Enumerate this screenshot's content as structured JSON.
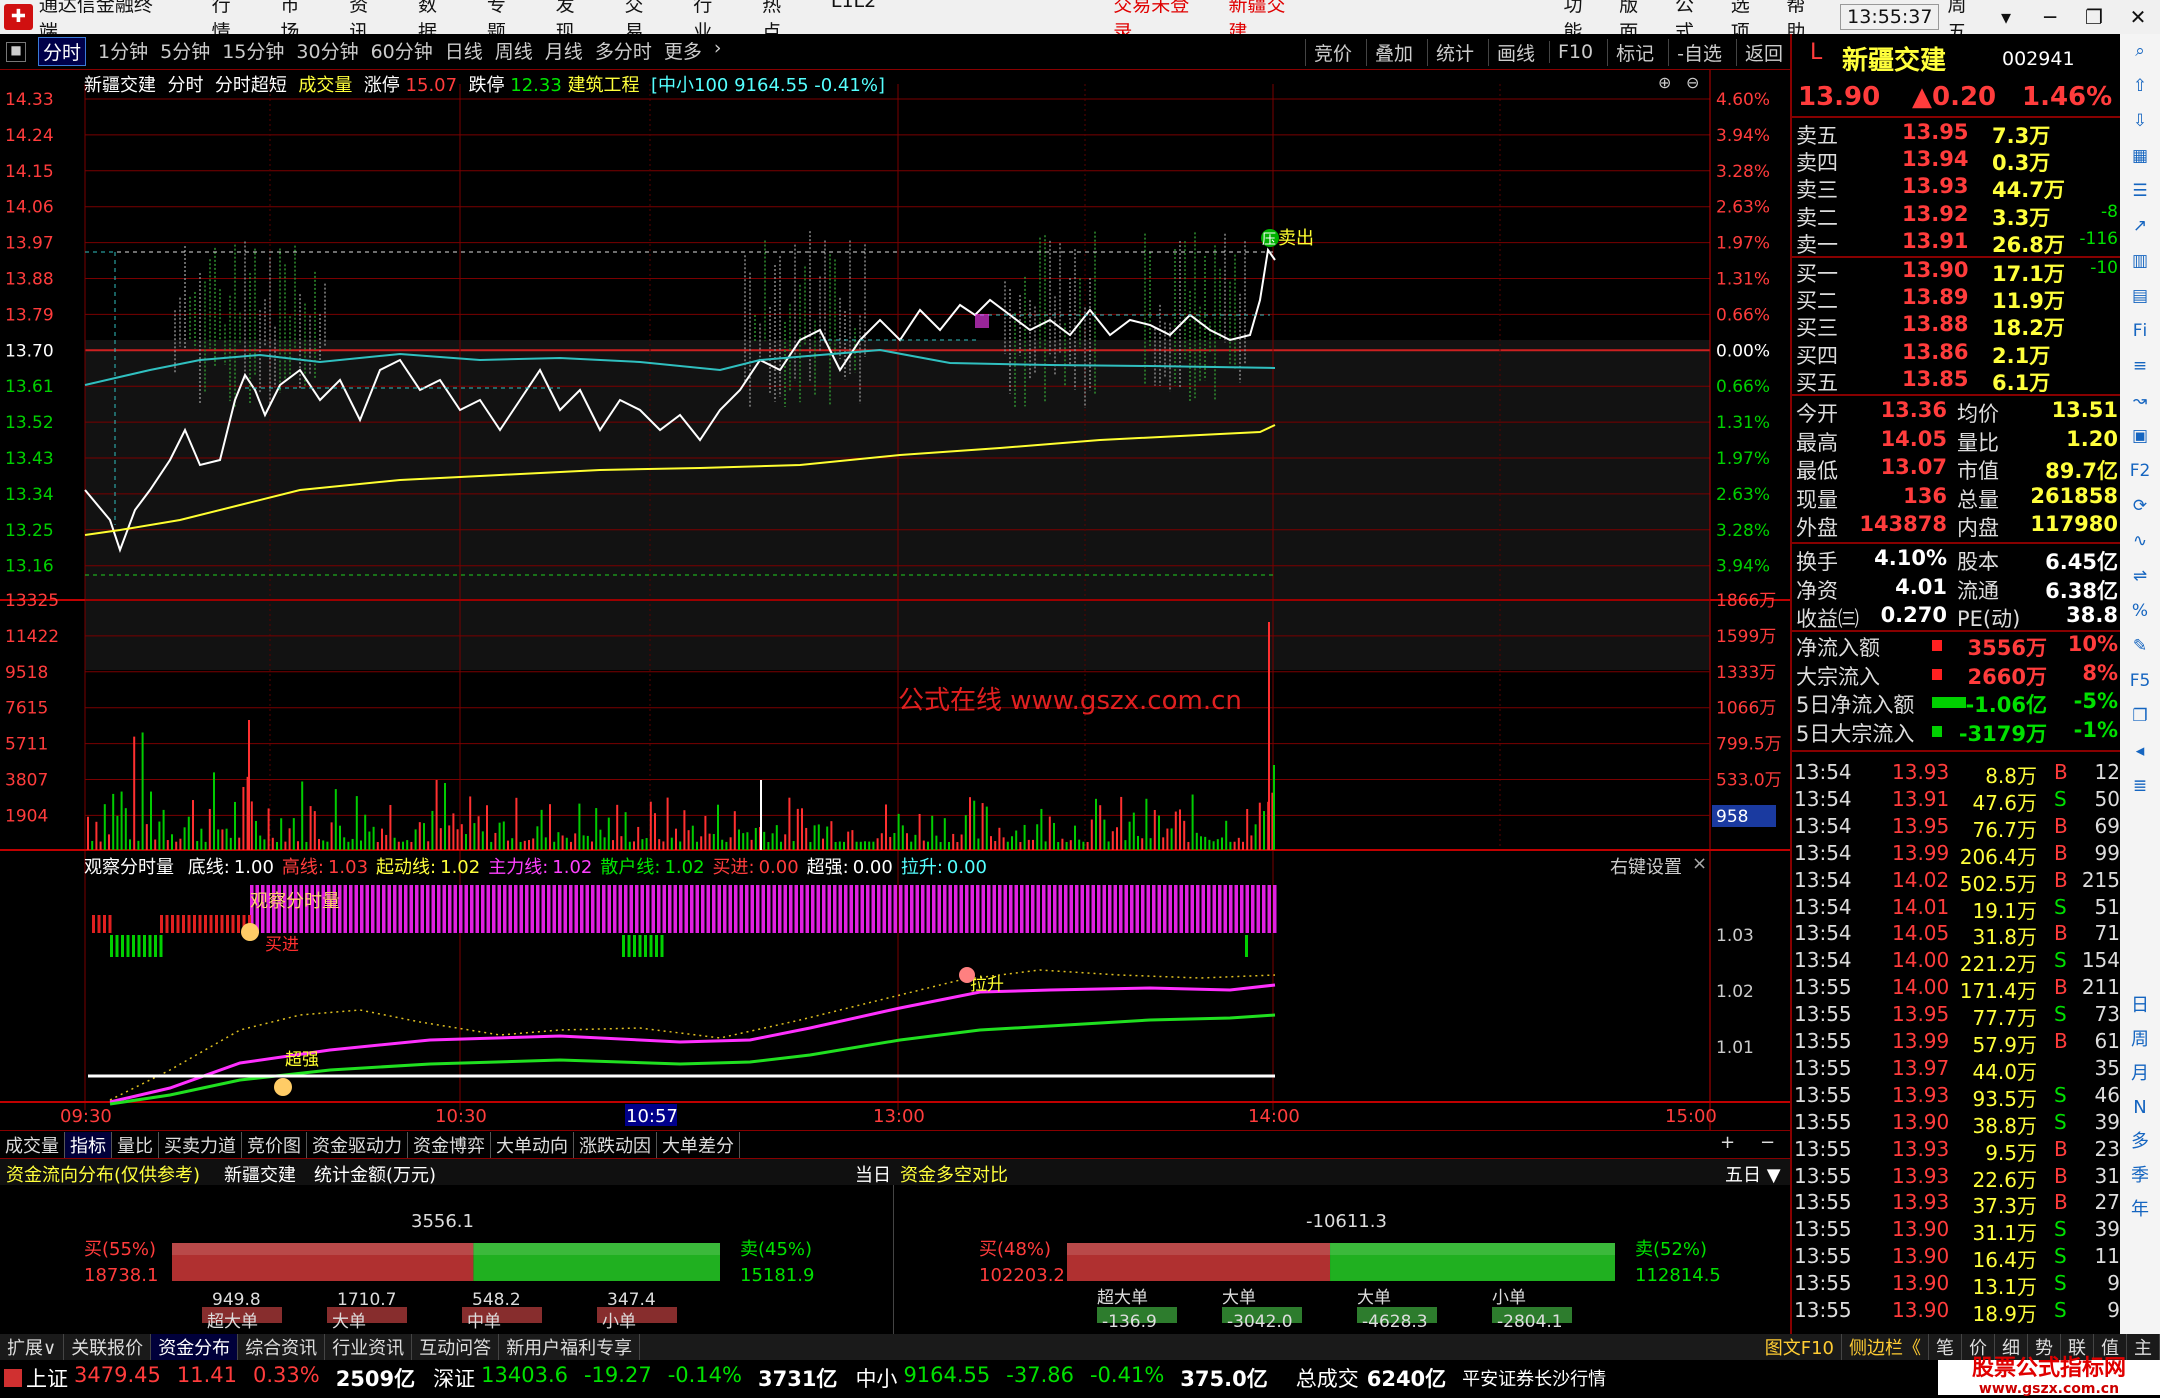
{
  "menubar": {
    "app_title": "通达信金融终端",
    "items": [
      "行情",
      "市场",
      "资讯",
      "数据",
      "专题",
      "发现",
      "交易",
      "行业",
      "热点",
      "L1L2"
    ],
    "trade_status": "交易未登录",
    "stock_name": "新疆交建",
    "right_items": [
      "功能",
      "版面",
      "公式",
      "选项",
      "帮助"
    ],
    "time": "13:55:37",
    "weekday": "周五"
  },
  "toolbar": {
    "periods": [
      "分时",
      "1分钟",
      "5分钟",
      "15分钟",
      "30分钟",
      "60分钟",
      "日线",
      "周线",
      "月线",
      "多分时",
      "更多"
    ],
    "active": "分时",
    "right_items": [
      "竞价",
      "叠加",
      "统计",
      "画线",
      "F10",
      "标记",
      "-自选",
      "返回"
    ]
  },
  "infoline": {
    "name": "新疆交建",
    "mode": "分时",
    "mode2": "分时超短",
    "vol_label": "成交量",
    "limit_up_label": "涨停",
    "limit_up": "15.07",
    "limit_down_label": "跌停",
    "limit_down": "12.33",
    "industry": "建筑工程",
    "index_info": "[中小100 9164.55 -0.41%]"
  },
  "price_axis": {
    "left": [
      "14.33",
      "14.24",
      "14.15",
      "14.06",
      "13.97",
      "13.88",
      "13.79",
      "13.70",
      "13.61",
      "13.52",
      "13.43",
      "13.34",
      "13.25",
      "13.16"
    ],
    "right": [
      "4.60%",
      "3.94%",
      "3.28%",
      "2.63%",
      "1.97%",
      "1.31%",
      "0.66%",
      "0.00%",
      "0.66%",
      "1.31%",
      "1.97%",
      "2.63%",
      "3.28%",
      "3.94%"
    ]
  },
  "volume_axis": {
    "left": [
      "13325",
      "11422",
      "9518",
      "7615",
      "5711",
      "3807",
      "1904"
    ],
    "right": [
      "1866万",
      "1599万",
      "1333万",
      "1066万",
      "799.5万",
      "533.0万"
    ],
    "current": "958"
  },
  "chart_labels": {
    "sell_mark": "卖出",
    "press": "压",
    "watermark": "公式在线  www.gszx.com.cn"
  },
  "indicator": {
    "title": "观察分时量",
    "items": [
      {
        "k": "底线:",
        "v": "1.00",
        "c": "wht"
      },
      {
        "k": "高线:",
        "v": "1.03",
        "c": "red"
      },
      {
        "k": "起动线:",
        "v": "1.02",
        "c": "yel"
      },
      {
        "k": "主力线:",
        "v": "1.02",
        "c": "mag"
      },
      {
        "k": "散户线:",
        "v": "1.02",
        "c": "grn"
      },
      {
        "k": "买进:",
        "v": "0.00",
        "c": "red"
      },
      {
        "k": "超强:",
        "v": "0.00",
        "c": "wht"
      },
      {
        "k": "拉升:",
        "v": "0.00",
        "c": "cyan"
      }
    ],
    "settings": "右键设置",
    "axis": [
      "1.03",
      "1.02",
      "1.01"
    ],
    "bar_label": "观察分时量",
    "buy_label": "买进",
    "strong_label": "超强",
    "lift_label": "拉升"
  },
  "time_axis": [
    "09:30",
    "10:30",
    "10:57",
    "13:00",
    "14:00",
    "15:00"
  ],
  "bottom_tabs": [
    "成交量",
    "指标",
    "量比",
    "买卖力道",
    "竞价图",
    "资金驱动力",
    "资金博弈",
    "大单动向",
    "涨跌动因",
    "大单差分"
  ],
  "flow": {
    "title": "资金流向分布(仅供参考)",
    "stock": "新疆交建",
    "unit": "统计金额(万元)",
    "today": "当日",
    "title2": "资金多空对比",
    "period": "五日",
    "left": {
      "net": "3556.1",
      "buy_label": "买(55%)",
      "buy": "18738.1",
      "sell_label": "卖(45%)",
      "sell": "15181.9",
      "buy_pct": 55,
      "cats": [
        {
          "v": "949.8",
          "n": "超大单"
        },
        {
          "v": "1710.7",
          "n": "大单"
        },
        {
          "v": "548.2",
          "n": "中单"
        },
        {
          "v": "347.4",
          "n": "小单"
        }
      ]
    },
    "right": {
      "net": "-10611.3",
      "buy_label": "买(48%)",
      "buy": "102203.2",
      "sell_label": "卖(52%)",
      "sell": "112814.5",
      "buy_pct": 48,
      "cats": [
        {
          "n": "超大单",
          "v": "-136.9"
        },
        {
          "n": "大单",
          "v": "-3042.0"
        },
        {
          "n": "大单",
          "v": "-4628.3"
        },
        {
          "n": "小单",
          "v": "-2804.1"
        }
      ]
    }
  },
  "statusbar": [
    "扩展∨",
    "关联报价",
    "资金分布",
    "综合资讯",
    "行业资讯",
    "互动问答",
    "新用户福利专享"
  ],
  "status_right": [
    "图文F10",
    "侧边栏《",
    "笔",
    "价",
    "细",
    "势",
    "联",
    "值",
    "主"
  ],
  "indexbar": [
    {
      "n": "上证",
      "v": "3479.45",
      "c": "11.41",
      "p": "0.33%",
      "a": "2509亿"
    },
    {
      "n": "深证",
      "v": "13403.6",
      "c": "-19.27",
      "p": "-0.14%",
      "a": "3731亿"
    },
    {
      "n": "中小",
      "v": "9164.55",
      "c": "-37.86",
      "p": "-0.41%",
      "a": "375.0亿"
    }
  ],
  "total_label": "总成交",
  "total": "6240亿",
  "broker": "平安证券长沙行情",
  "site_logo": "股票公式指标网",
  "site_url": "www.gszx.com.cn",
  "quote": {
    "name": "新疆交建",
    "code": "002941",
    "price": "13.90",
    "chg": "▲0.20",
    "pct": "1.46%",
    "asks": [
      {
        "l": "卖五",
        "p": "13.95",
        "v": "7.3万",
        "d": ""
      },
      {
        "l": "卖四",
        "p": "13.94",
        "v": "0.3万",
        "d": ""
      },
      {
        "l": "卖三",
        "p": "13.93",
        "v": "44.7万",
        "d": ""
      },
      {
        "l": "卖二",
        "p": "13.92",
        "v": "3.3万",
        "d": "-8"
      },
      {
        "l": "卖一",
        "p": "13.91",
        "v": "26.8万",
        "d": "-116"
      }
    ],
    "bids": [
      {
        "l": "买一",
        "p": "13.90",
        "v": "17.1万",
        "d": "-10"
      },
      {
        "l": "买二",
        "p": "13.89",
        "v": "11.9万",
        "d": ""
      },
      {
        "l": "买三",
        "p": "13.88",
        "v": "18.2万",
        "d": ""
      },
      {
        "l": "买四",
        "p": "13.86",
        "v": "2.1万",
        "d": ""
      },
      {
        "l": "买五",
        "p": "13.85",
        "v": "6.1万",
        "d": ""
      }
    ],
    "stats": [
      {
        "a": "今开",
        "b": "13.36",
        "c": "均价",
        "d": "13.51"
      },
      {
        "a": "最高",
        "b": "14.05",
        "c": "量比",
        "d": "1.20"
      },
      {
        "a": "最低",
        "b": "13.07",
        "c": "市值",
        "d": "89.7亿"
      },
      {
        "a": "现量",
        "b": "136",
        "c": "总量",
        "d": "261858"
      },
      {
        "a": "外盘",
        "b": "143878",
        "c": "内盘",
        "d": "117980"
      }
    ],
    "fin": [
      {
        "a": "换手",
        "b": "4.10%",
        "c": "股本",
        "d": "6.45亿"
      },
      {
        "a": "净资",
        "b": "4.01",
        "c": "流通",
        "d": "6.38亿"
      },
      {
        "a": "收益㈢",
        "b": "0.270",
        "c": "PE(动)",
        "d": "38.8"
      }
    ],
    "flows": [
      {
        "a": "净流入额",
        "b": "3556万",
        "c": "10%"
      },
      {
        "a": "大宗流入",
        "b": "2660万",
        "c": "8%"
      },
      {
        "a": "5日净流入额",
        "b": "-1.06亿",
        "c": "-5%"
      },
      {
        "a": "5日大宗流入",
        "b": "-3179万",
        "c": "-1%"
      }
    ],
    "ticks": [
      [
        "13:54",
        "13.93",
        "8.8万",
        "B",
        "12"
      ],
      [
        "13:54",
        "13.91",
        "47.6万",
        "S",
        "50"
      ],
      [
        "13:54",
        "13.95",
        "76.7万",
        "B",
        "69"
      ],
      [
        "13:54",
        "13.99",
        "206.4万",
        "B",
        "99"
      ],
      [
        "13:54",
        "14.02",
        "502.5万",
        "B",
        "215"
      ],
      [
        "13:54",
        "14.01",
        "19.1万",
        "S",
        "51"
      ],
      [
        "13:54",
        "14.05",
        "31.8万",
        "B",
        "71"
      ],
      [
        "13:54",
        "14.00",
        "221.2万",
        "S",
        "154"
      ],
      [
        "13:55",
        "14.00",
        "171.4万",
        "B",
        "211"
      ],
      [
        "13:55",
        "13.95",
        "77.7万",
        "S",
        "73"
      ],
      [
        "13:55",
        "13.99",
        "57.9万",
        "B",
        "61"
      ],
      [
        "13:55",
        "13.97",
        "44.0万",
        "",
        "35"
      ],
      [
        "13:55",
        "13.93",
        "93.5万",
        "S",
        "46"
      ],
      [
        "13:55",
        "13.90",
        "38.8万",
        "S",
        "39"
      ],
      [
        "13:55",
        "13.93",
        "9.5万",
        "B",
        "23"
      ],
      [
        "13:55",
        "13.93",
        "22.6万",
        "B",
        "31"
      ],
      [
        "13:55",
        "13.93",
        "37.3万",
        "B",
        "27"
      ],
      [
        "13:55",
        "13.90",
        "31.1万",
        "S",
        "39"
      ],
      [
        "13:55",
        "13.90",
        "16.4万",
        "S",
        "11"
      ],
      [
        "13:55",
        "13.90",
        "13.1万",
        "S",
        "9"
      ],
      [
        "13:55",
        "13.90",
        "18.9万",
        "S",
        "9"
      ]
    ]
  },
  "side_tools": [
    "日",
    "周",
    "月",
    "N",
    "多",
    "季",
    "年"
  ]
}
